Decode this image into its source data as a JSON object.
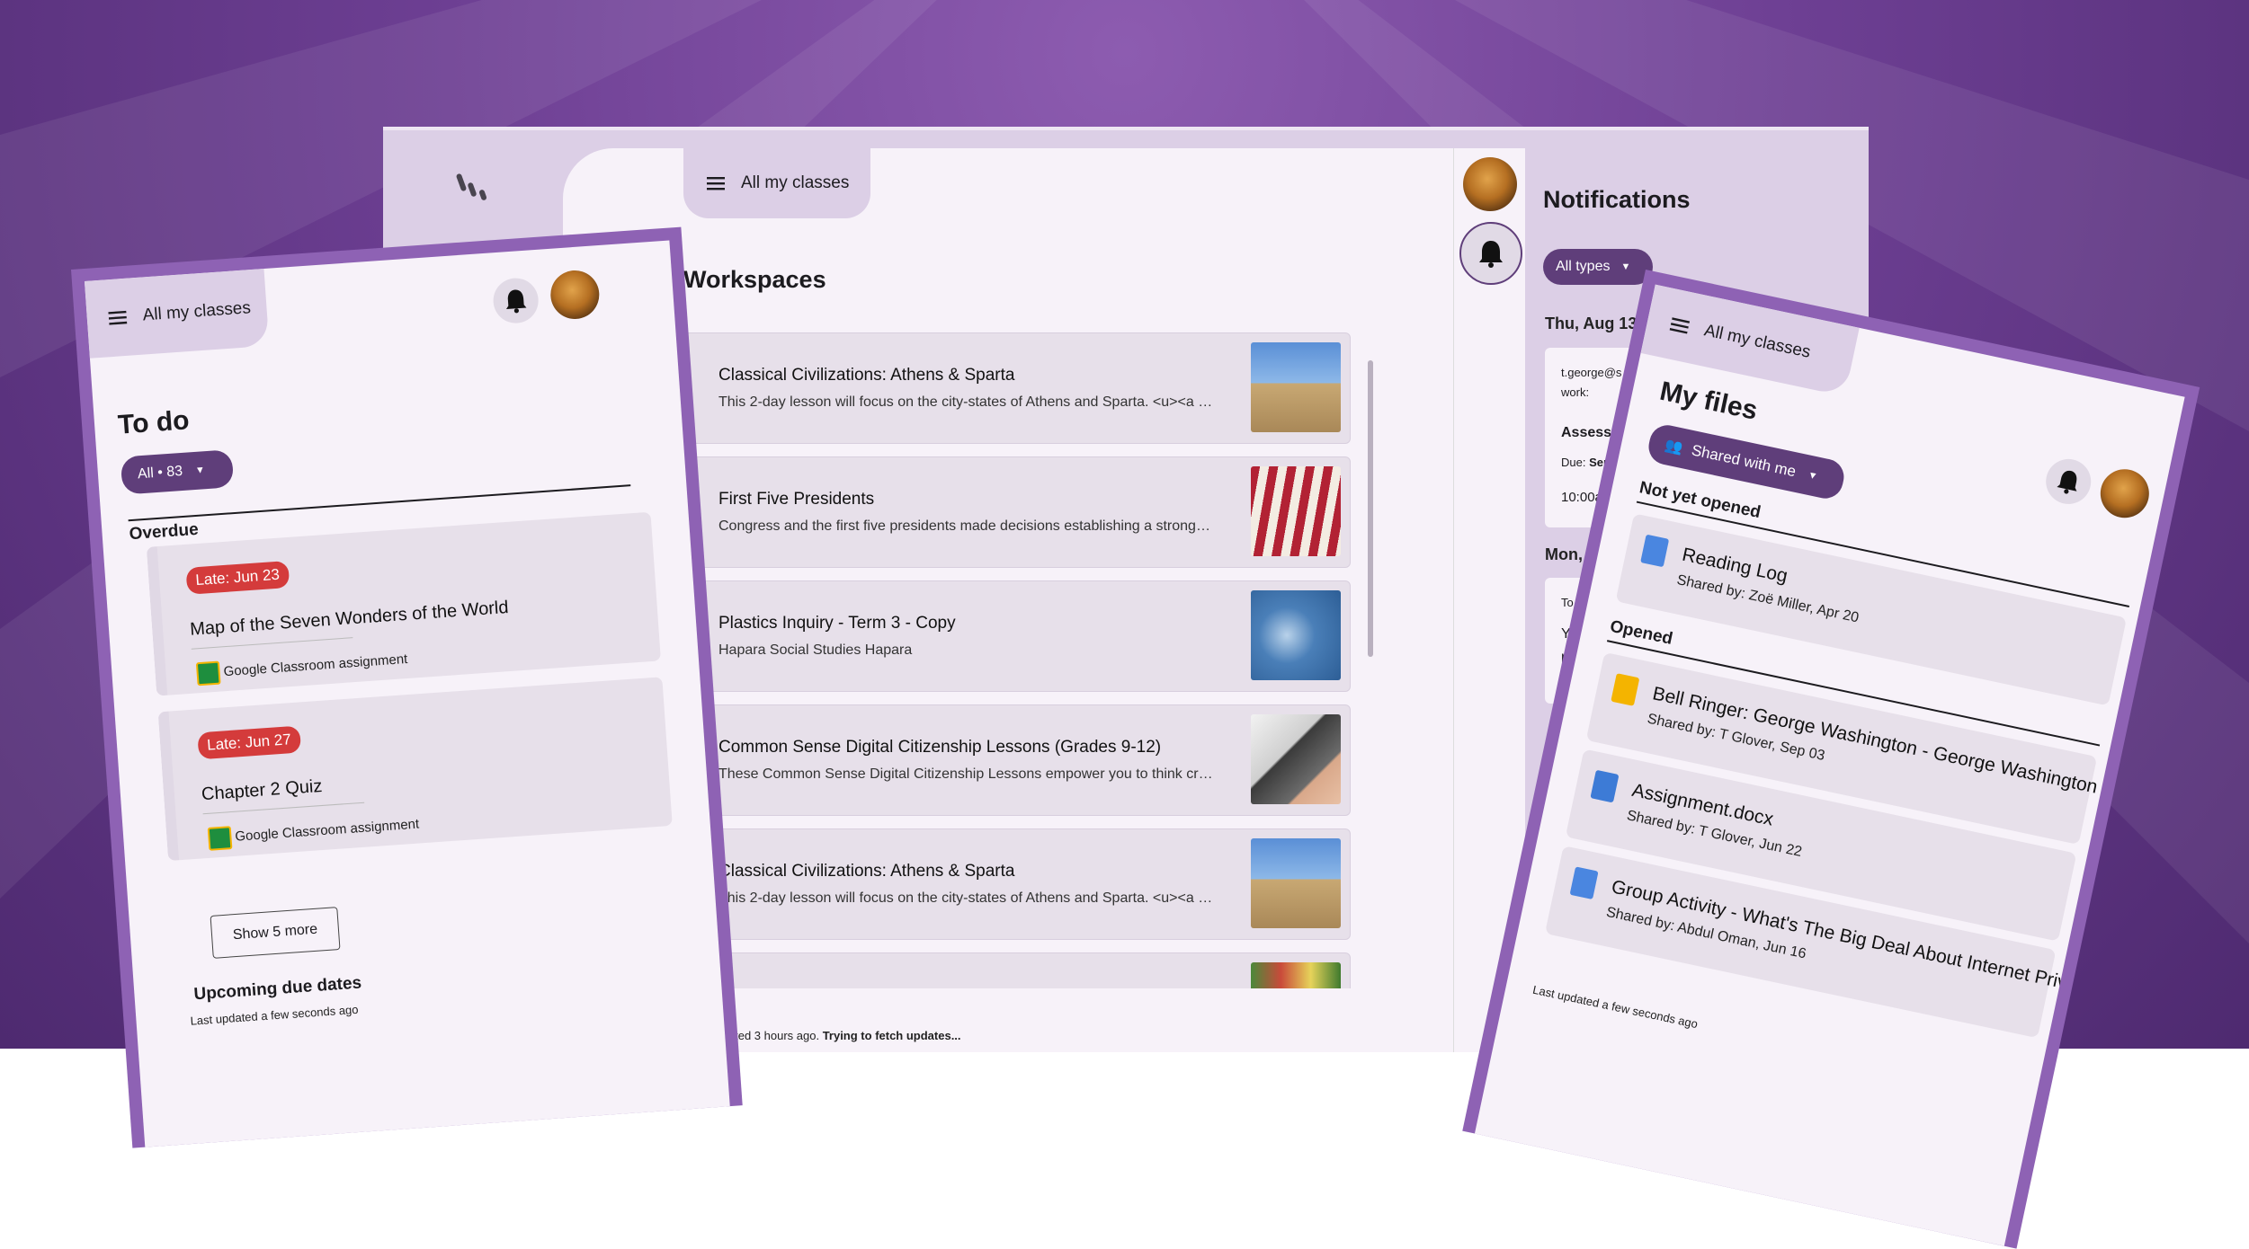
{
  "main": {
    "class_selector": "All my classes",
    "workspaces_heading": "Workspaces",
    "workspaces": [
      {
        "title": "Classical Civilizations: Athens & Sparta",
        "description": "This 2-day lesson will focus on the city-states of Athens and Sparta. <u><a href=\"https://www.youtube.com/watch",
        "thumb": "acropolis"
      },
      {
        "title": "First Five Presidents",
        "description": "Congress and the first five presidents made decisions establishing a strong nation.",
        "thumb": "flag"
      },
      {
        "title": "Plastics Inquiry - Term 3 - Copy",
        "description": "Hapara Social Studies Hapara",
        "thumb": "plastic"
      },
      {
        "title": "Common Sense Digital Citizenship Lessons (Grades 9-12)",
        "description": "These Common Sense Digital Citizenship Lessons empower you to think critically",
        "thumb": "laptop"
      },
      {
        "title": "Classical Civilizations: Athens & Sparta",
        "description": "This 2-day lesson will focus on the city-states of Athens and Sparta. <u><a href=\"https://www.youtube.com/watch",
        "thumb": "acropolis"
      },
      {
        "title": "",
        "description": "",
        "thumb": "veggies"
      }
    ],
    "status_prefix": "Last updated 3 hours ago.",
    "status_bold": "Trying to fetch updates..."
  },
  "notifications": {
    "heading": "Notifications",
    "filter": "All types",
    "groups": [
      {
        "date": "Thu, Aug 13",
        "email": "t.george@s",
        "line2": "work:",
        "item": "Assess",
        "due_label": "Due:",
        "due_value": "Sep",
        "time": "10:00a"
      },
      {
        "date": "Mon,",
        "line1": "To",
        "line2": "Y",
        "line3": "p"
      }
    ]
  },
  "left_panel": {
    "class_selector": "All my classes",
    "heading": "To do",
    "filter": "All • 83",
    "overdue": "Overdue",
    "tasks": [
      {
        "late": "Late: Jun 23",
        "title": "Map of the Seven Wonders of the World",
        "type": "Google Classroom assignment"
      },
      {
        "late": "Late: Jun 27",
        "title": "Chapter 2 Quiz",
        "type": "Google Classroom assignment"
      }
    ],
    "show_more": "Show 5 more",
    "upcoming": "Upcoming due dates",
    "status": "Last updated a few seconds ago"
  },
  "right_panel": {
    "class_selector": "All my classes",
    "heading": "My files",
    "filter": "Shared with me",
    "not_yet_opened": "Not yet opened",
    "opened": "Opened",
    "files": [
      {
        "name": "Reading Log",
        "shared": "Shared by: Zoë Miller, Apr 20",
        "type": "doc"
      },
      {
        "name": "Bell Ringer: George Washington - George Washington",
        "shared": "Shared by: T Glover, Sep 03",
        "type": "slides"
      },
      {
        "name": "Assignment.docx",
        "shared": "Shared by: T Glover, Jun 22",
        "type": "word"
      },
      {
        "name": "Group Activity - What's The Big Deal About Internet Priv...",
        "shared": "Shared by: Abdul Oman, Jun 16",
        "type": "doc"
      }
    ],
    "status": "Last updated a few seconds ago"
  },
  "colors": {
    "accent": "#5f3e7a",
    "late": "#d43b3b",
    "surface": "#f7f2f9",
    "rail": "#dccfe6"
  }
}
